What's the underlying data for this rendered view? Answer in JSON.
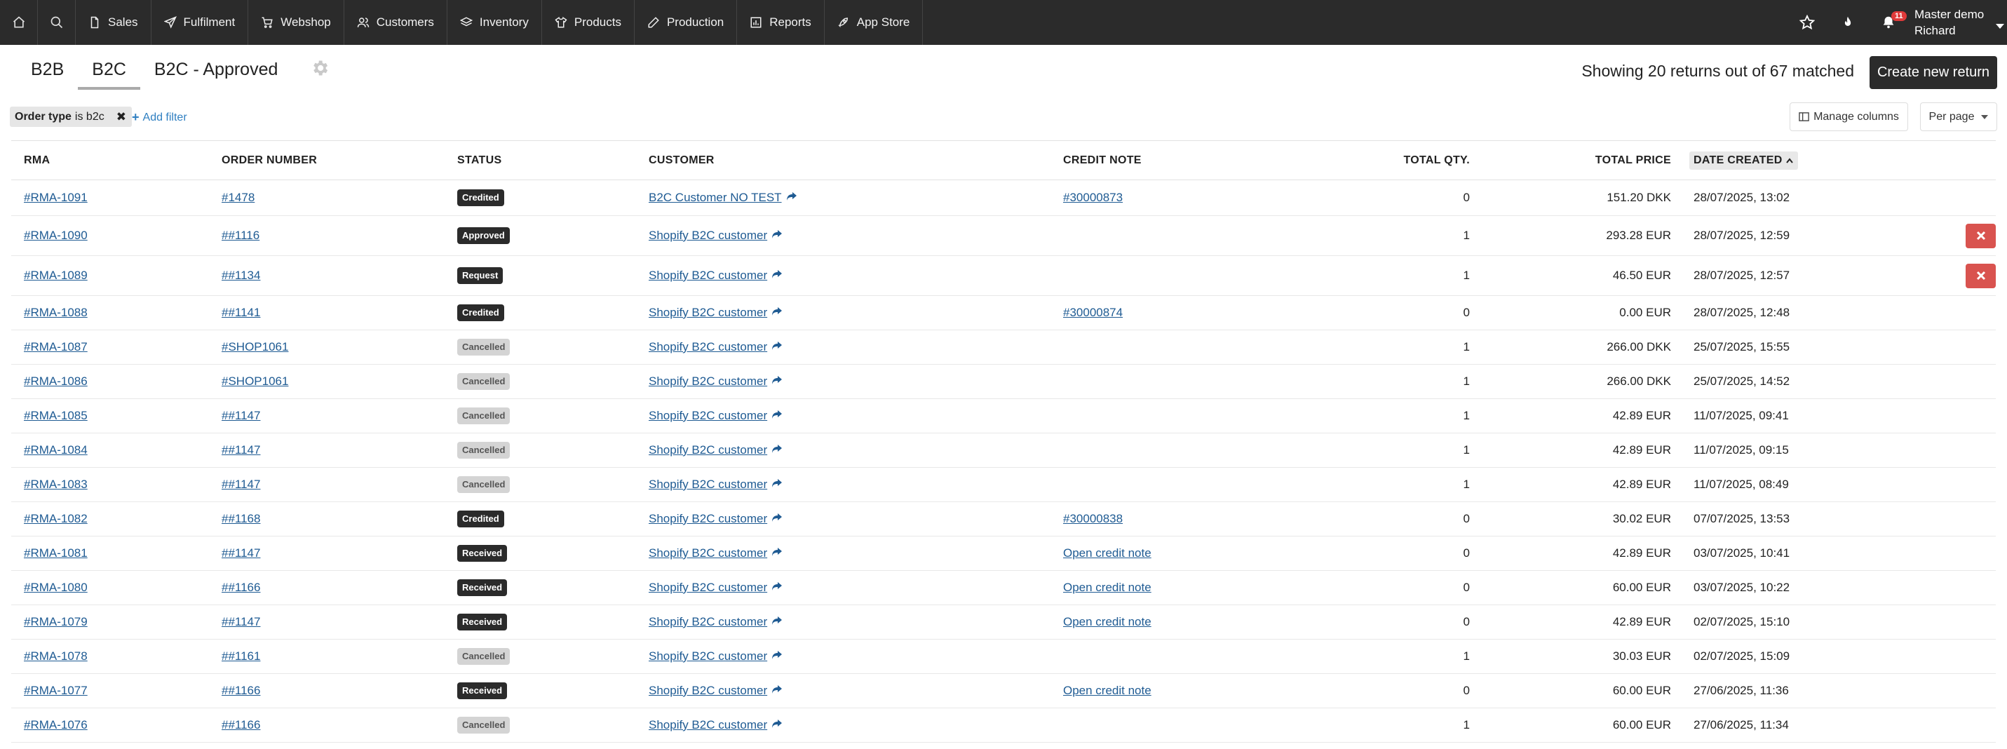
{
  "nav": {
    "items": [
      {
        "label": "Sales",
        "icon": "file-icon"
      },
      {
        "label": "Fulfilment",
        "icon": "paper-plane-icon"
      },
      {
        "label": "Webshop",
        "icon": "cart-icon"
      },
      {
        "label": "Customers",
        "icon": "users-icon"
      },
      {
        "label": "Inventory",
        "icon": "layers-icon"
      },
      {
        "label": "Products",
        "icon": "shirt-icon"
      },
      {
        "label": "Production",
        "icon": "pencil-icon"
      },
      {
        "label": "Reports",
        "icon": "chart-icon"
      },
      {
        "label": "App Store",
        "icon": "rocket-icon"
      }
    ],
    "notification_count": "11",
    "user_line1": "Master demo",
    "user_line2": "Richard"
  },
  "tabs": [
    {
      "label": "B2B",
      "active": false
    },
    {
      "label": "B2C",
      "active": true
    },
    {
      "label": "B2C - Approved",
      "active": false
    }
  ],
  "header": {
    "matched_text": "Showing 20 returns out of 67 matched",
    "create_label": "Create new return"
  },
  "filter": {
    "field": "Order type",
    "op_value": "is b2c",
    "add_label": "Add filter"
  },
  "toolbar": {
    "manage_columns": "Manage columns",
    "per_page": "Per page"
  },
  "table": {
    "columns": [
      "RMA",
      "ORDER NUMBER",
      "STATUS",
      "CUSTOMER",
      "CREDIT NOTE",
      "TOTAL QTY.",
      "TOTAL PRICE",
      "DATE CREATED"
    ],
    "rows": [
      {
        "rma": "#RMA-1091",
        "order": "#1478",
        "status": "Credited",
        "customer": "B2C Customer NO TEST",
        "credit": "#30000873",
        "qty": "0",
        "price": "151.20 DKK",
        "date": "28/07/2025, 13:02",
        "delete": false
      },
      {
        "rma": "#RMA-1090",
        "order": "##1116",
        "status": "Approved",
        "customer": "Shopify B2C customer",
        "credit": "",
        "qty": "1",
        "price": "293.28 EUR",
        "date": "28/07/2025, 12:59",
        "delete": true
      },
      {
        "rma": "#RMA-1089",
        "order": "##1134",
        "status": "Request",
        "customer": "Shopify B2C customer",
        "credit": "",
        "qty": "1",
        "price": "46.50 EUR",
        "date": "28/07/2025, 12:57",
        "delete": true
      },
      {
        "rma": "#RMA-1088",
        "order": "##1141",
        "status": "Credited",
        "customer": "Shopify B2C customer",
        "credit": "#30000874",
        "qty": "0",
        "price": "0.00 EUR",
        "date": "28/07/2025, 12:48",
        "delete": false
      },
      {
        "rma": "#RMA-1087",
        "order": "#SHOP1061",
        "status": "Cancelled",
        "customer": "Shopify B2C customer",
        "credit": "",
        "qty": "1",
        "price": "266.00 DKK",
        "date": "25/07/2025, 15:55",
        "delete": false
      },
      {
        "rma": "#RMA-1086",
        "order": "#SHOP1061",
        "status": "Cancelled",
        "customer": "Shopify B2C customer",
        "credit": "",
        "qty": "1",
        "price": "266.00 DKK",
        "date": "25/07/2025, 14:52",
        "delete": false
      },
      {
        "rma": "#RMA-1085",
        "order": "##1147",
        "status": "Cancelled",
        "customer": "Shopify B2C customer",
        "credit": "",
        "qty": "1",
        "price": "42.89 EUR",
        "date": "11/07/2025, 09:41",
        "delete": false
      },
      {
        "rma": "#RMA-1084",
        "order": "##1147",
        "status": "Cancelled",
        "customer": "Shopify B2C customer",
        "credit": "",
        "qty": "1",
        "price": "42.89 EUR",
        "date": "11/07/2025, 09:15",
        "delete": false
      },
      {
        "rma": "#RMA-1083",
        "order": "##1147",
        "status": "Cancelled",
        "customer": "Shopify B2C customer",
        "credit": "",
        "qty": "1",
        "price": "42.89 EUR",
        "date": "11/07/2025, 08:49",
        "delete": false
      },
      {
        "rma": "#RMA-1082",
        "order": "##1168",
        "status": "Credited",
        "customer": "Shopify B2C customer",
        "credit": "#30000838",
        "qty": "0",
        "price": "30.02 EUR",
        "date": "07/07/2025, 13:53",
        "delete": false
      },
      {
        "rma": "#RMA-1081",
        "order": "##1147",
        "status": "Received",
        "customer": "Shopify B2C customer",
        "credit": "Open credit note",
        "qty": "0",
        "price": "42.89 EUR",
        "date": "03/07/2025, 10:41",
        "delete": false
      },
      {
        "rma": "#RMA-1080",
        "order": "##1166",
        "status": "Received",
        "customer": "Shopify B2C customer",
        "credit": "Open credit note",
        "qty": "0",
        "price": "60.00 EUR",
        "date": "03/07/2025, 10:22",
        "delete": false
      },
      {
        "rma": "#RMA-1079",
        "order": "##1147",
        "status": "Received",
        "customer": "Shopify B2C customer",
        "credit": "Open credit note",
        "qty": "0",
        "price": "42.89 EUR",
        "date": "02/07/2025, 15:10",
        "delete": false
      },
      {
        "rma": "#RMA-1078",
        "order": "##1161",
        "status": "Cancelled",
        "customer": "Shopify B2C customer",
        "credit": "",
        "qty": "1",
        "price": "30.03 EUR",
        "date": "02/07/2025, 15:09",
        "delete": false
      },
      {
        "rma": "#RMA-1077",
        "order": "##1166",
        "status": "Received",
        "customer": "Shopify B2C customer",
        "credit": "Open credit note",
        "qty": "0",
        "price": "60.00 EUR",
        "date": "27/06/2025, 11:36",
        "delete": false
      },
      {
        "rma": "#RMA-1076",
        "order": "##1166",
        "status": "Cancelled",
        "customer": "Shopify B2C customer",
        "credit": "",
        "qty": "1",
        "price": "60.00 EUR",
        "date": "27/06/2025, 11:34",
        "delete": false
      }
    ]
  },
  "colors": {
    "nav_bg": "#2b2b2b",
    "link": "#1f5b93",
    "danger": "#d9534f",
    "badge_dark": "#2b2b2b",
    "badge_light": "#d4d4d4"
  }
}
